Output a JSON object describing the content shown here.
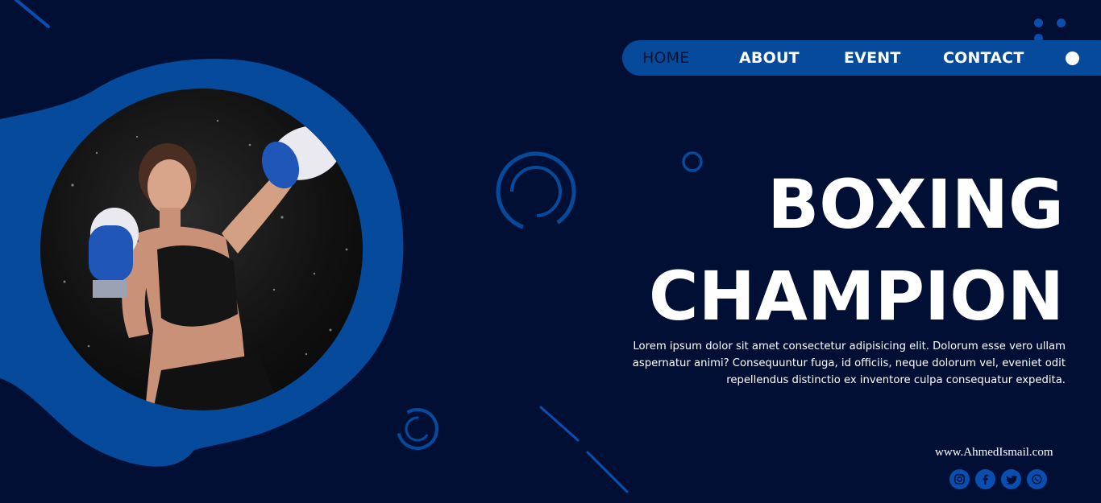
{
  "nav": {
    "items": [
      {
        "label": "HOME",
        "active": true
      },
      {
        "label": "ABOUT"
      },
      {
        "label": "EVENT"
      },
      {
        "label": "CONTACT"
      }
    ]
  },
  "hero": {
    "title_line1": "BOXING",
    "title_line2": "CHAMPION",
    "description_line1": "Lorem ipsum dolor sit amet consectetur adipisicing elit. Dolorum esse vero ullam",
    "description_line2": "aspernatur animi? Consequuntur fuga, id officiis, neque dolorum vel, eveniet odit",
    "description_line3": "repellendus distinctio ex inventore culpa consequatur expedita."
  },
  "footer": {
    "website": "www.AhmedIsmail.com",
    "social": [
      "instagram-icon",
      "facebook-icon",
      "twitter-icon",
      "whatsapp-icon"
    ]
  },
  "colors": {
    "background": "#000f33",
    "accent": "#064a9c",
    "text": "#ffffff"
  }
}
